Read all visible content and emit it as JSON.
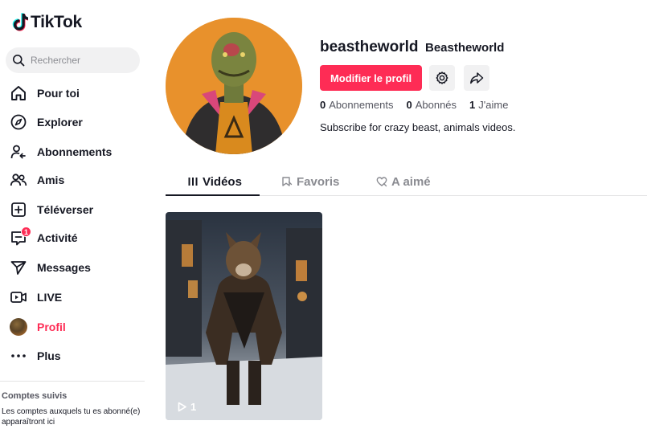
{
  "app": {
    "name": "TikTok"
  },
  "search": {
    "placeholder": "Rechercher"
  },
  "sidebar": {
    "items": [
      {
        "label": "Pour toi",
        "icon": "home-icon"
      },
      {
        "label": "Explorer",
        "icon": "compass-icon"
      },
      {
        "label": "Abonnements",
        "icon": "following-icon"
      },
      {
        "label": "Amis",
        "icon": "friends-icon"
      },
      {
        "label": "Téléverser",
        "icon": "upload-icon"
      },
      {
        "label": "Activité",
        "icon": "inbox-icon",
        "badge": "1"
      },
      {
        "label": "Messages",
        "icon": "send-icon"
      },
      {
        "label": "LIVE",
        "icon": "live-icon"
      },
      {
        "label": "Profil",
        "icon": "avatar",
        "active": true
      },
      {
        "label": "Plus",
        "icon": "more-icon"
      }
    ],
    "followed": {
      "title": "Comptes suivis",
      "description": "Les comptes auxquels tu es abonné(e) apparaîtront ici"
    }
  },
  "profile": {
    "username": "beastheworld",
    "nickname": "Beastheworld",
    "edit_label": "Modifier le profil",
    "stats": {
      "following": {
        "value": "0",
        "label": "Abonnements"
      },
      "followers": {
        "value": "0",
        "label": "Abonnés"
      },
      "likes": {
        "value": "1",
        "label": "J'aime"
      }
    },
    "bio": "Subscribe for crazy beast, animals videos."
  },
  "tabs": [
    {
      "label": "Vidéos",
      "icon": "grid-icon",
      "active": true
    },
    {
      "label": "Favoris",
      "icon": "bookmark-icon"
    },
    {
      "label": "A aimé",
      "icon": "heart-icon"
    }
  ],
  "videos": [
    {
      "views": "1",
      "icon": "play-icon"
    }
  ],
  "colors": {
    "accent": "#fe2c55",
    "text": "#161823",
    "muted": "#8a8b91",
    "surface": "#f1f1f2",
    "avatar_bg": "#e8912c"
  }
}
